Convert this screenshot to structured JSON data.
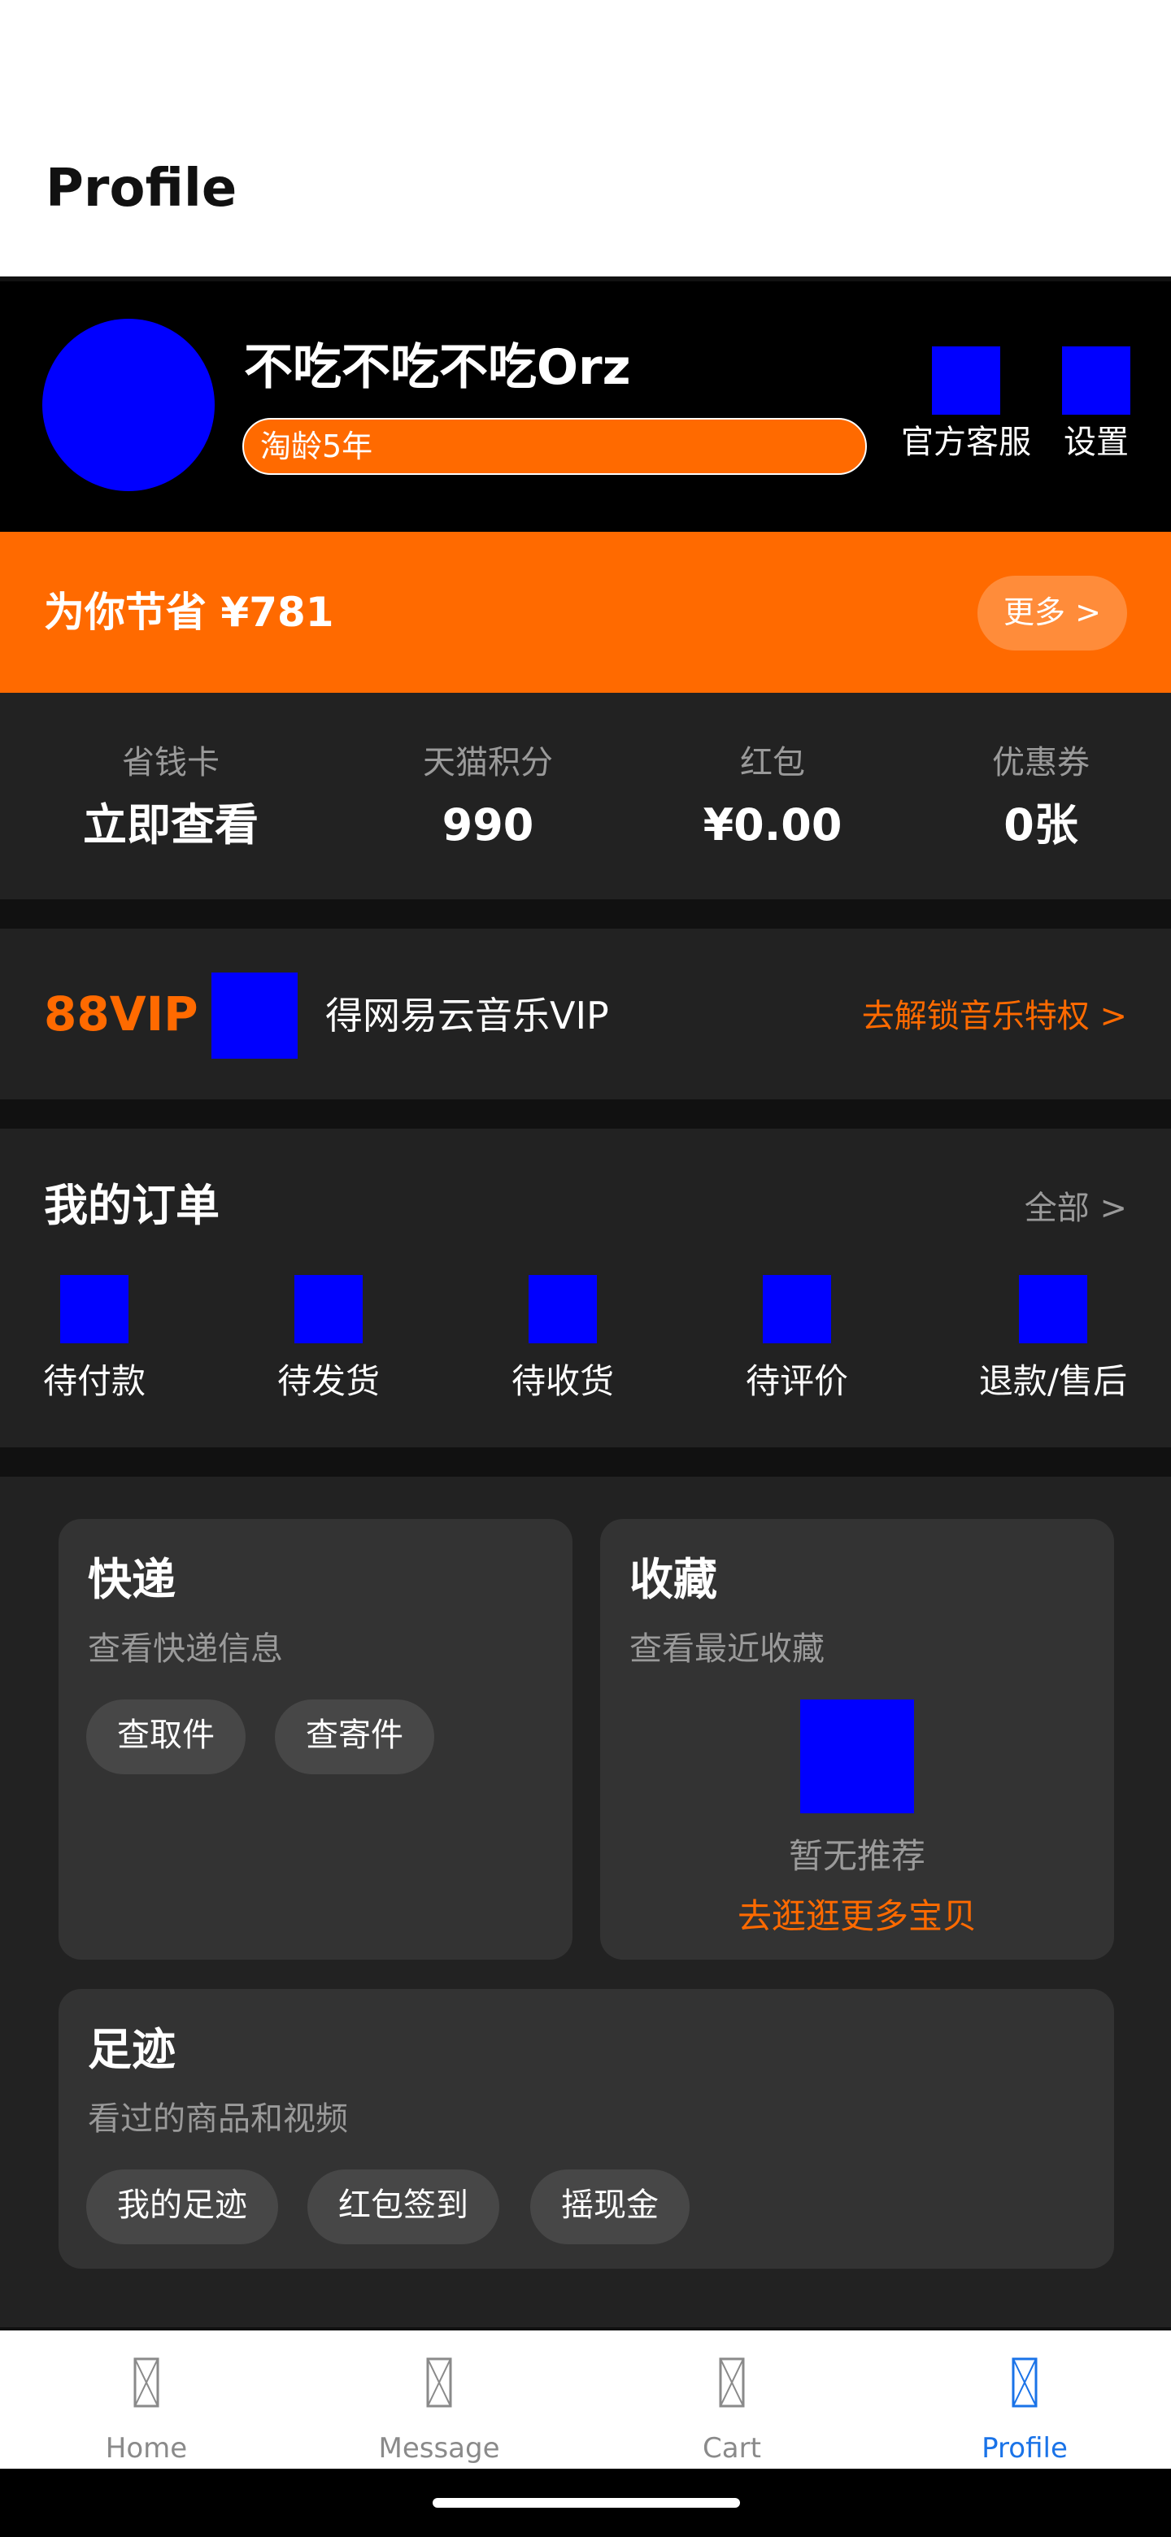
{
  "header": {
    "title": "Profile"
  },
  "profile": {
    "username": "不吃不吃不吃Orz",
    "badge": "淘龄5年",
    "tools": [
      {
        "label": "官方客服",
        "icon": "customer-service-icon"
      },
      {
        "label": "设置",
        "icon": "settings-icon"
      }
    ]
  },
  "savings": {
    "title": "为你节省 ¥781",
    "more": "更多 >"
  },
  "assets": [
    {
      "label": "省钱卡",
      "value": "立即查看"
    },
    {
      "label": "天猫积分",
      "value": "990"
    },
    {
      "label": "红包",
      "value": "¥0.00"
    },
    {
      "label": "优惠券",
      "value": "0张"
    }
  ],
  "vip": {
    "title": "88VIP",
    "text": "得网易云音乐VIP",
    "link": "去解锁音乐特权 >"
  },
  "orders": {
    "title": "我的订单",
    "all": "全部 >",
    "items": [
      {
        "label": "待付款",
        "icon": "pending-payment-icon"
      },
      {
        "label": "待发货",
        "icon": "pending-shipment-icon"
      },
      {
        "label": "待收货",
        "icon": "pending-receipt-icon"
      },
      {
        "label": "待评价",
        "icon": "pending-review-icon"
      },
      {
        "label": "退款/售后",
        "icon": "refund-icon"
      }
    ]
  },
  "express": {
    "title": "快递",
    "subtitle": "查看快递信息",
    "chips": [
      "查取件",
      "查寄件"
    ]
  },
  "favorites": {
    "title": "收藏",
    "subtitle": "查看最近收藏",
    "empty": "暂无推荐",
    "link": "去逛逛更多宝贝"
  },
  "footprints": {
    "title": "足迹",
    "subtitle": "看过的商品和视频",
    "chips": [
      "我的足迹",
      "红包签到",
      "摇现金"
    ]
  },
  "nav": {
    "items": [
      {
        "label": "Home",
        "icon": "home-icon",
        "active": false
      },
      {
        "label": "Message",
        "icon": "message-icon",
        "active": false
      },
      {
        "label": "Cart",
        "icon": "cart-icon",
        "active": false
      },
      {
        "label": "Profile",
        "icon": "profile-icon",
        "active": true
      }
    ],
    "active_color": "#1a73e8",
    "inactive_color": "#8a8a8a"
  },
  "colors": {
    "accent": "#ff6a00",
    "placeholder": "#0000ff",
    "panel": "#222222",
    "card": "#333333"
  }
}
